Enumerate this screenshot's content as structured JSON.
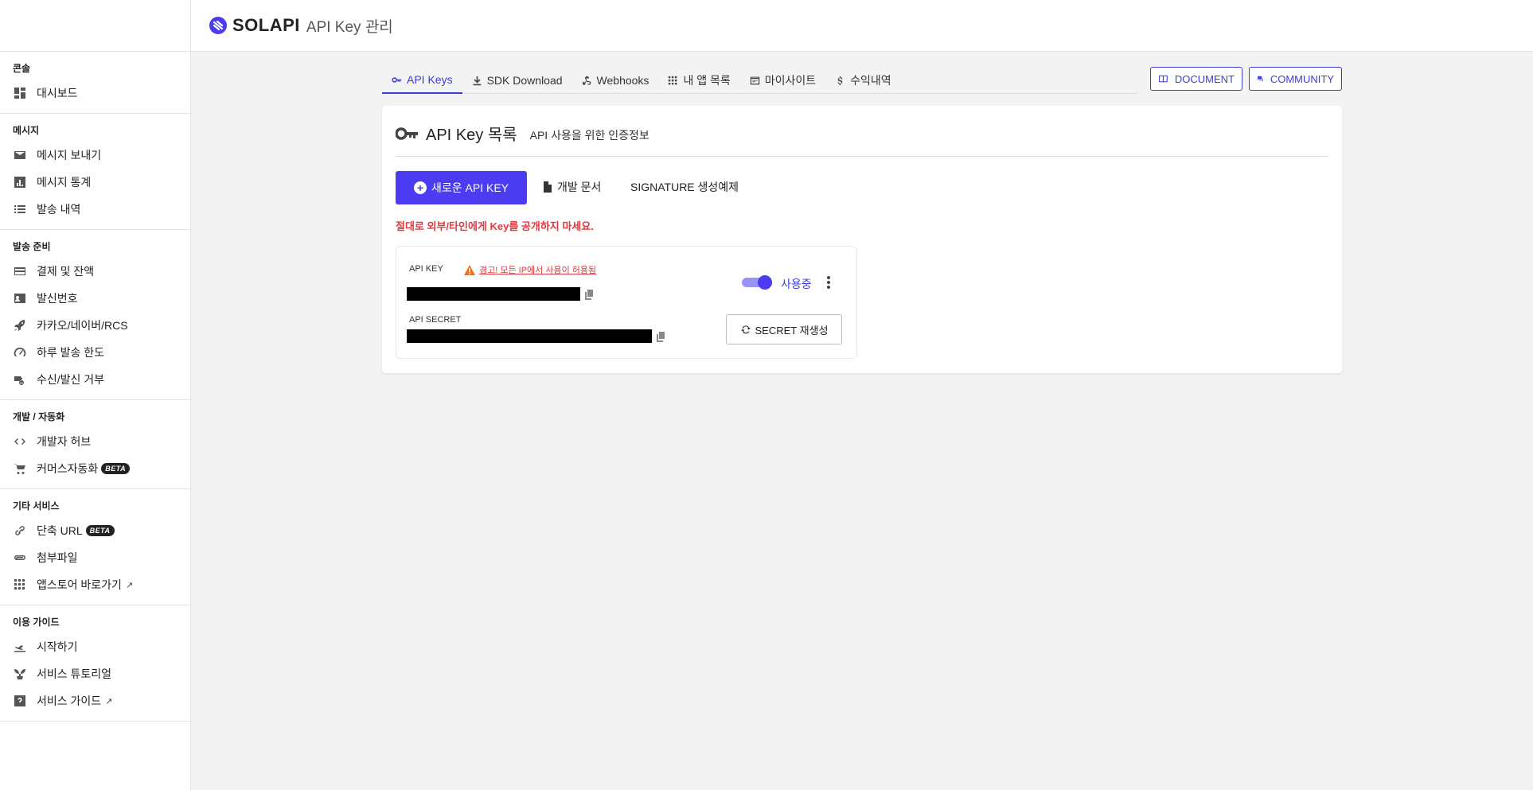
{
  "header": {
    "brand": "SOLAPI",
    "page_name": "API Key 관리"
  },
  "sidebar": {
    "sections": [
      {
        "title": "콘솔",
        "items": [
          {
            "label": "대시보드",
            "icon": "dashboard-icon"
          }
        ]
      },
      {
        "title": "메시지",
        "items": [
          {
            "label": "메시지 보내기",
            "icon": "mail-icon"
          },
          {
            "label": "메시지 통계",
            "icon": "bar-chart-icon"
          },
          {
            "label": "발송 내역",
            "icon": "list-icon"
          }
        ]
      },
      {
        "title": "발송 준비",
        "items": [
          {
            "label": "결제 및 잔액",
            "icon": "credit-card-icon"
          },
          {
            "label": "발신번호",
            "icon": "contact-card-icon"
          },
          {
            "label": "카카오/네이버/RCS",
            "icon": "rocket-icon"
          },
          {
            "label": "하루 발송 한도",
            "icon": "speedometer-icon"
          },
          {
            "label": "수신/발신 거부",
            "icon": "block-icon"
          }
        ]
      },
      {
        "title": "개발 / 자동화",
        "items": [
          {
            "label": "개발자 허브",
            "icon": "code-icon"
          },
          {
            "label": "커머스자동화",
            "icon": "cart-icon",
            "badge": "BETA"
          }
        ]
      },
      {
        "title": "기타 서비스",
        "items": [
          {
            "label": "단축 URL",
            "icon": "link-icon",
            "badge": "BETA"
          },
          {
            "label": "첨부파일",
            "icon": "attachment-icon"
          },
          {
            "label": "앱스토어 바로가기",
            "icon": "apps-icon",
            "external": true
          }
        ]
      },
      {
        "title": "이용 가이드",
        "items": [
          {
            "label": "시작하기",
            "icon": "takeoff-icon"
          },
          {
            "label": "서비스 튜토리얼",
            "icon": "sprout-icon"
          },
          {
            "label": "서비스 가이드",
            "icon": "help-icon",
            "external": true
          }
        ]
      }
    ]
  },
  "tabs": [
    {
      "label": "API Keys",
      "icon": "key-icon",
      "active": true
    },
    {
      "label": "SDK Download",
      "icon": "download-icon"
    },
    {
      "label": "Webhooks",
      "icon": "webhook-icon"
    },
    {
      "label": "내 앱 목록",
      "icon": "apps-icon"
    },
    {
      "label": "마이사이트",
      "icon": "browser-icon"
    },
    {
      "label": "수익내역",
      "icon": "dollar-icon"
    }
  ],
  "top_buttons": {
    "document": "DOCUMENT",
    "community": "COMMUNITY"
  },
  "card": {
    "title": "API Key 목록",
    "subtitle": "API 사용을 위한 인증정보",
    "new_key_button": "새로운 API KEY",
    "dev_doc_link": "개발 문서",
    "signature_link": "SIGNATURE 생성예제",
    "warning": "절대로 외부/타인에게 Key를 공개하지 마세요.",
    "key_box": {
      "api_key_label": "API KEY",
      "ip_warning": "경고! 모든 IP에서 사용이 허용됨",
      "api_secret_label": "API SECRET",
      "status_label": "사용중",
      "status_on": true,
      "regen_button": "SECRET 재생성"
    }
  },
  "colors": {
    "accent": "#4b3cf2",
    "danger": "#e0393e"
  }
}
